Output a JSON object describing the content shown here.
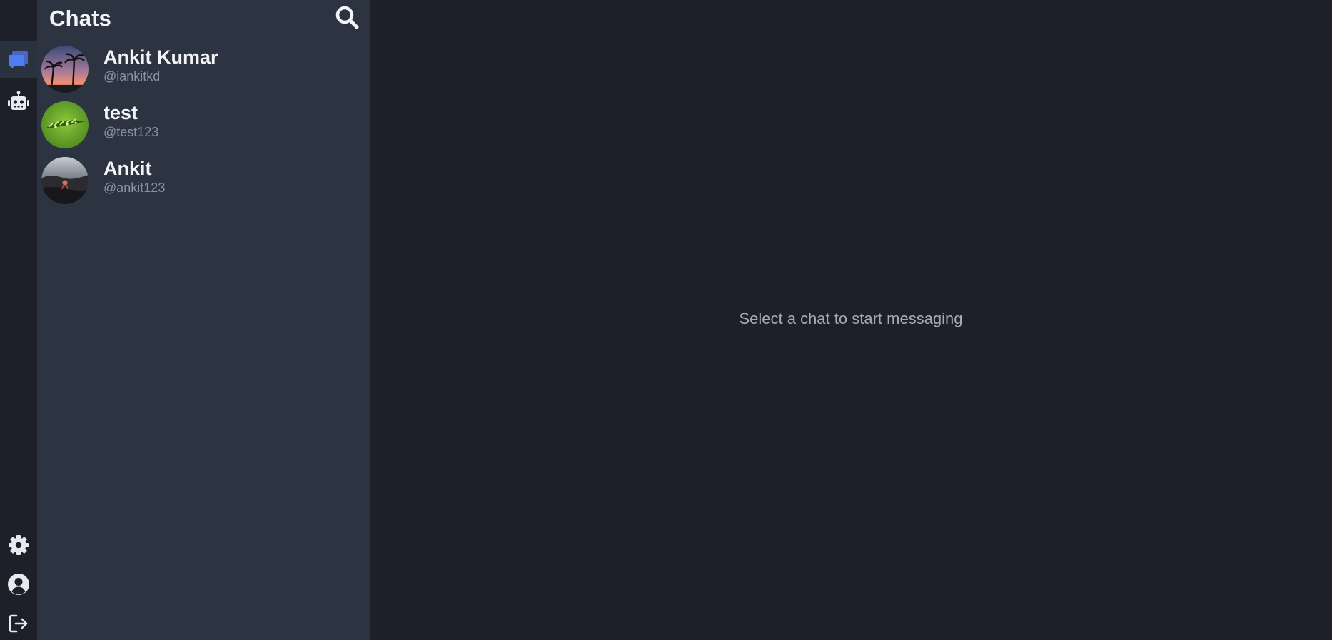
{
  "sidebar": {
    "items": [
      {
        "icon": "chats-icon",
        "active": true
      },
      {
        "icon": "robot-icon",
        "active": false
      }
    ],
    "bottom_items": [
      {
        "icon": "gear-icon"
      },
      {
        "icon": "user-circle-icon"
      },
      {
        "icon": "logout-icon"
      }
    ]
  },
  "chat_panel": {
    "title": "Chats",
    "search_icon": "search-icon",
    "chats": [
      {
        "name": "Ankit Kumar",
        "handle": "@iankitkd",
        "avatar": "sunset-palms"
      },
      {
        "name": "test",
        "handle": "@test123",
        "avatar": "green-leaf"
      },
      {
        "name": "Ankit",
        "handle": "@ankit123",
        "avatar": "dark-landscape"
      }
    ]
  },
  "main": {
    "empty_message": "Select a chat to start messaging"
  },
  "colors": {
    "accent": "#4f7cf0",
    "rail_bg": "#1d2029",
    "panel_bg": "#2d3441",
    "main_bg": "#1d2029",
    "text_primary": "#f2f4f7",
    "text_secondary": "#8a93a3"
  }
}
